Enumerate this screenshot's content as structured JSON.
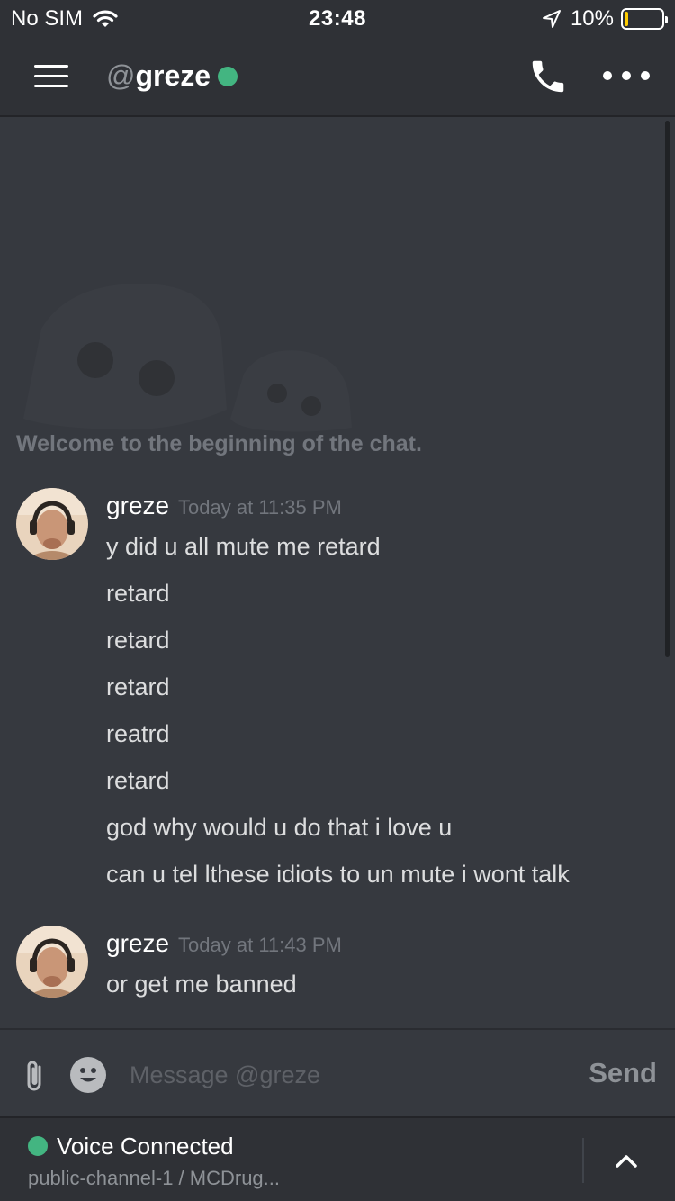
{
  "status_bar": {
    "carrier": "No SIM",
    "time": "23:48",
    "battery_percent": "10%",
    "battery_level": 0.1,
    "icons": [
      "wifi-icon",
      "location-arrow-icon",
      "battery-icon"
    ]
  },
  "header": {
    "at_symbol": "@",
    "username": "greze",
    "status": "online",
    "icons": [
      "hamburger-menu-icon",
      "phone-icon",
      "more-icon"
    ]
  },
  "chat": {
    "welcome": "Welcome to the beginning of the chat.",
    "messages": [
      {
        "author": "greze",
        "timestamp": "Today at 11:35 PM",
        "lines": [
          "y did u all mute me retard",
          "retard",
          "retard",
          "retard",
          "reatrd",
          "retard",
          "god why would u do that i love u",
          "can u tel lthese idiots to un mute i wont talk"
        ]
      },
      {
        "author": "greze",
        "timestamp": "Today at 11:43 PM",
        "lines": [
          "or get me banned"
        ]
      }
    ]
  },
  "composer": {
    "placeholder": "Message @greze",
    "send_label": "Send"
  },
  "voice": {
    "status": "Voice Connected",
    "channel": "public-channel-1 / MCDrug..."
  },
  "colors": {
    "background": "#36393f",
    "header": "#2f3136",
    "online": "#43b581",
    "battery": "#ffcc00"
  }
}
